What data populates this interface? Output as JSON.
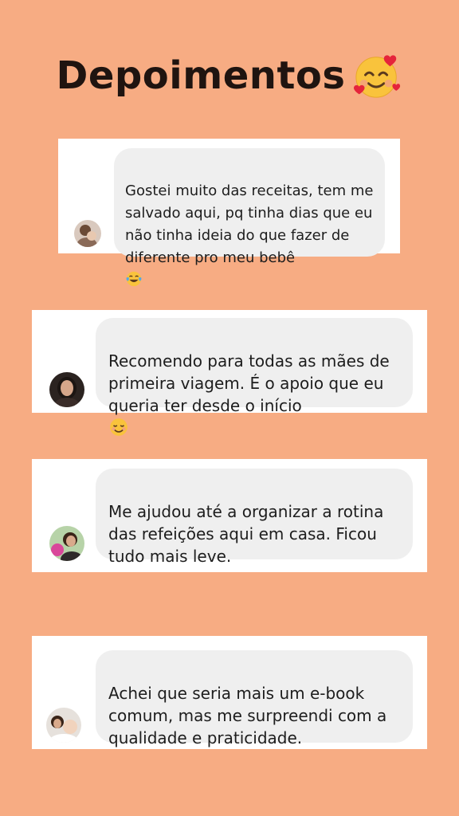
{
  "header": {
    "title": "Depoimentos",
    "title_emoji_icon": "smiling-face-with-hearts-icon"
  },
  "colors": {
    "background": "#F7AC83",
    "card": "#FFFFFF",
    "bubble": "#EFEFEF",
    "title": "#1F1410"
  },
  "testimonials": [
    {
      "text": "Gostei muito das receitas, tem me\nsalvado aqui, pq tinha dias que eu\nnão tinha ideia do que fazer de\ndiferente pro meu bebê",
      "emoji_icon": "face-with-tears-of-joy-icon",
      "avatar_icon": "user-avatar-photo"
    },
    {
      "text": "Recomendo para todas as mães de\nprimeira viagem. É o apoio que eu\nqueria ter desde o início",
      "emoji_icon": "smiling-face-icon",
      "avatar_icon": "user-avatar-photo"
    },
    {
      "text": "Me ajudou até a organizar a rotina\ndas refeições aqui em casa. Ficou\ntudo mais leve.",
      "avatar_icon": "user-avatar-photo"
    },
    {
      "text": "Achei que seria mais um e-book\ncomum, mas me surpreendi com a\nqualidade e praticidade.",
      "avatar_icon": "user-avatar-photo"
    }
  ]
}
